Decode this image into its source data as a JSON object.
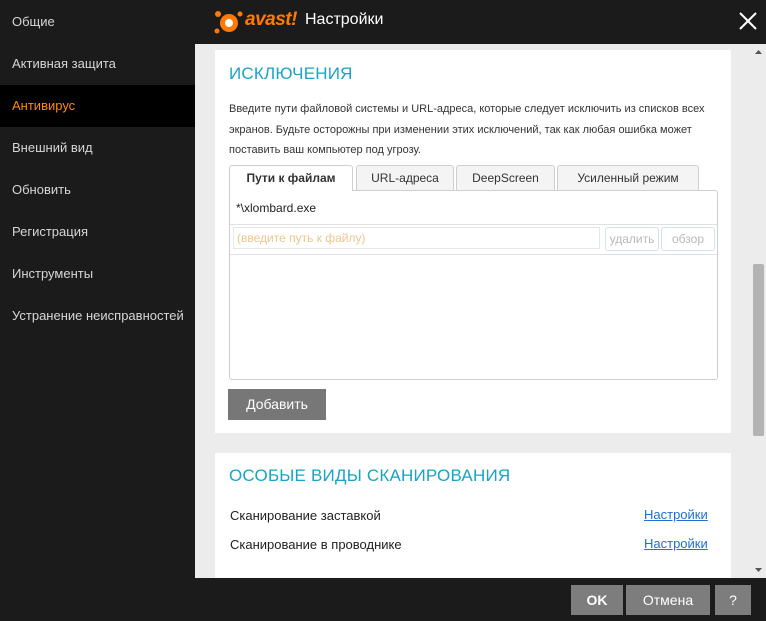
{
  "window": {
    "brand": "avast!",
    "title": "Настройки"
  },
  "sidebar": {
    "items": [
      {
        "label": "Общие"
      },
      {
        "label": "Активная защита"
      },
      {
        "label": "Антивирус"
      },
      {
        "label": "Внешний вид"
      },
      {
        "label": "Обновить"
      },
      {
        "label": "Регистрация"
      },
      {
        "label": "Инструменты"
      },
      {
        "label": "Устранение неисправностей"
      }
    ],
    "active_index": 2
  },
  "exclusions": {
    "title": "ИСКЛЮЧЕНИЯ",
    "description": "Введите пути файловой системы и URL-адреса, которые следует исключить из списков всех экранов. Будьте осторожны при изменении этих исключений, так как любая ошибка может поставить ваш компьютер под угрозу.",
    "tabs": [
      {
        "label": "Пути к файлам"
      },
      {
        "label": "URL-адреса"
      },
      {
        "label": "DeepScreen"
      },
      {
        "label": "Усиленный режим"
      }
    ],
    "active_tab": 0,
    "entries": [
      "*\\xlombard.exe"
    ],
    "input_placeholder": "(введите путь к файлу)",
    "input_value": "",
    "delete_label": "удалить",
    "browse_label": "обзор",
    "add_label": "Добавить"
  },
  "special_scans": {
    "title": "ОСОБЫЕ ВИДЫ СКАНИРОВАНИЯ",
    "items": [
      {
        "label": "Сканирование заставкой",
        "link": "Настройки"
      },
      {
        "label": "Сканирование в проводнике",
        "link": "Настройки"
      }
    ]
  },
  "footer": {
    "ok_label": "OK",
    "cancel_label": "Отмена",
    "help_label": "?"
  },
  "colors": {
    "accent_orange": "#ff8a00",
    "section_title_blue": "#1aa3c7",
    "link_blue": "#1f6ed4",
    "sidebar_bg": "#1b1b1b"
  }
}
